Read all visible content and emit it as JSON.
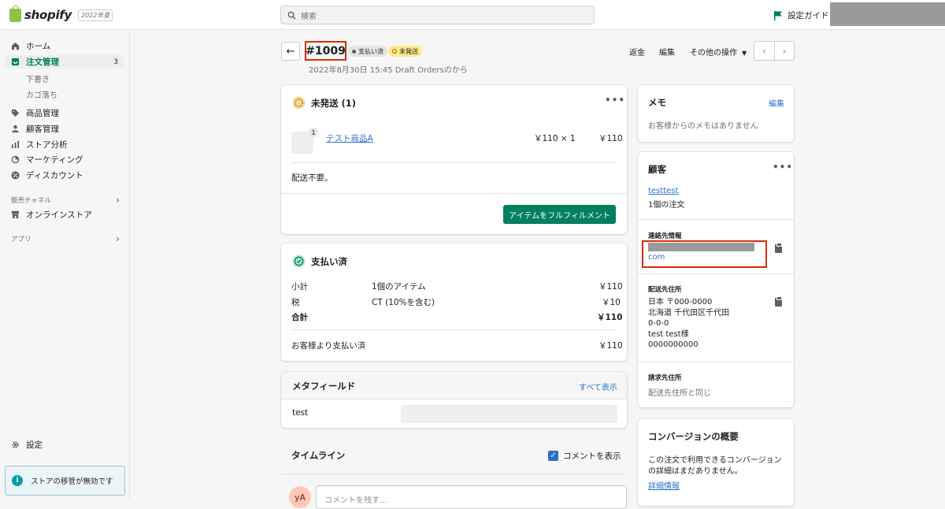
{
  "topbar": {
    "logo_text": "shopify",
    "edition": "2022年夏",
    "search_placeholder": "検索",
    "setup_guide": "設定ガイド"
  },
  "sidebar": {
    "items": [
      {
        "label": "ホーム",
        "icon": "home-icon"
      },
      {
        "label": "注文管理",
        "icon": "inbox-icon",
        "count": "3",
        "active": true
      },
      {
        "label": "下書き"
      },
      {
        "label": "カゴ落ち"
      },
      {
        "label": "商品管理",
        "icon": "tag-icon"
      },
      {
        "label": "顧客管理",
        "icon": "person-icon"
      },
      {
        "label": "ストア分析",
        "icon": "bar-chart-icon"
      },
      {
        "label": "マーケティング",
        "icon": "marketing-icon"
      },
      {
        "label": "ディスカウント",
        "icon": "discount-icon"
      }
    ],
    "sales_channels": "販売チャネル",
    "online_store": "オンラインストア",
    "apps": "アプリ",
    "settings": "設定",
    "banner": "ストアの移管が無効です"
  },
  "header": {
    "order_number": "#1009",
    "badge_paid": "支払い済",
    "badge_unfulfilled": "未発送",
    "subtitle": "2022年8月30日 15:45 Draft Ordersのから",
    "refund": "返金",
    "edit": "編集",
    "more_actions": "その他の操作"
  },
  "unfulfilled": {
    "title": "未発送 (1)",
    "item_name": "テスト商品A",
    "item_qty_badge": "1",
    "item_price_qty": "￥110 × 1",
    "item_total": "￥110",
    "shipping_note": "配送不要。",
    "fulfill_button": "アイテムをフルフィルメント"
  },
  "payment": {
    "title": "支払い済",
    "rows": [
      {
        "label": "小計",
        "desc": "1個のアイテム",
        "amount": "￥110"
      },
      {
        "label": "税",
        "desc": "CT (10%を含む)",
        "amount": "￥10"
      },
      {
        "label": "合計",
        "desc": "",
        "amount": "￥110"
      }
    ],
    "paid_by_customer_label": "お客様より支払い済",
    "paid_by_customer_amount": "￥110"
  },
  "metafields": {
    "title": "メタフィールド",
    "show_all": "すべて表示",
    "field_label": "test"
  },
  "timeline": {
    "title": "タイムライン",
    "show_comments": "コメントを表示",
    "avatar_initials": "yA",
    "comment_placeholder": "コメントを残す..."
  },
  "memo": {
    "title": "メモ",
    "edit": "編集",
    "empty": "お客様からのメモはありません"
  },
  "customer": {
    "title": "顧客",
    "name": "testtest",
    "orders": "1個の注文",
    "contact_title": "連絡先情報",
    "email_tail": "com",
    "shipping_title": "配送先住所",
    "shipping_lines": [
      "日本 〒000-0000",
      "北海道 千代田区千代田",
      "0-0-0",
      "test test様",
      "0000000000"
    ],
    "billing_title": "請求先住所",
    "billing_same": "配送先住所と同じ"
  },
  "conversion": {
    "title": "コンバージョンの概要",
    "text1": "この注文で利用できるコンバージョン",
    "text2": "の詳細はまだありません。",
    "details_link": "詳細情報"
  },
  "colors": {
    "accent_green": "#008060",
    "highlight_red": "#d72c0d",
    "link_blue": "#2c6ecb"
  }
}
